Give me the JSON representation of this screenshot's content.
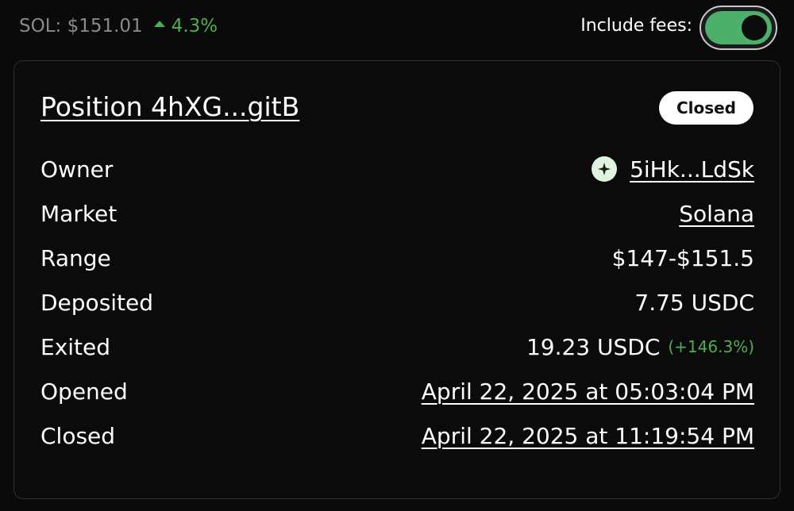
{
  "header": {
    "price_label": "SOL: $151.01",
    "price_change": "4.3%",
    "fees_label": "Include fees:",
    "fees_enabled": true
  },
  "position": {
    "title": "Position 4hXG...gitB",
    "status": "Closed",
    "rows": {
      "owner": {
        "label": "Owner",
        "value": "5iHk...LdSk",
        "icon": "sparkle-icon"
      },
      "market": {
        "label": "Market",
        "value": "Solana"
      },
      "range": {
        "label": "Range",
        "value": "$147-$151.5"
      },
      "deposited": {
        "label": "Deposited",
        "value": "7.75 USDC"
      },
      "exited": {
        "label": "Exited",
        "value": "19.23 USDC",
        "change": "(+146.3%)"
      },
      "opened": {
        "label": "Opened",
        "value": "April 22, 2025 at 05:03:04 PM"
      },
      "closed": {
        "label": "Closed",
        "value": "April 22, 2025 at 11:19:54 PM"
      }
    }
  },
  "colors": {
    "background": "#0a0a0b",
    "accent_green": "#4caf50",
    "toggle_track": "#4caf6a"
  }
}
